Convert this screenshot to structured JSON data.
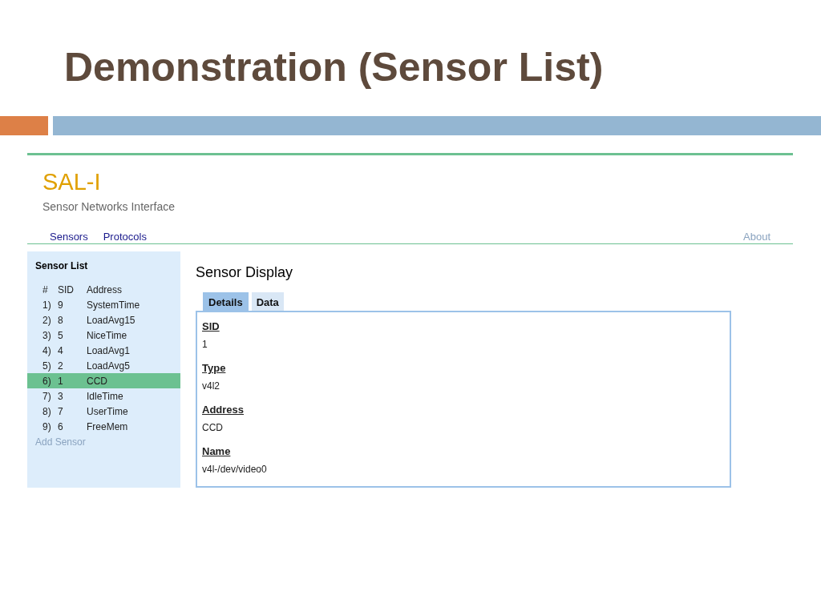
{
  "slide": {
    "title": "Demonstration (Sensor List)"
  },
  "app": {
    "title": "SAL-I",
    "subtitle": "Sensor Networks Interface",
    "nav": [
      {
        "label": "Sensors"
      },
      {
        "label": "Protocols"
      }
    ],
    "nav_right": "About"
  },
  "sidebar": {
    "title": "Sensor List",
    "columns": [
      "#",
      "SID",
      "Address"
    ],
    "rows": [
      {
        "index": "1)",
        "sid": "9",
        "address": "SystemTime",
        "selected": false
      },
      {
        "index": "2)",
        "sid": "8",
        "address": "LoadAvg15",
        "selected": false
      },
      {
        "index": "3)",
        "sid": "5",
        "address": "NiceTime",
        "selected": false
      },
      {
        "index": "4)",
        "sid": "4",
        "address": "LoadAvg1",
        "selected": false
      },
      {
        "index": "5)",
        "sid": "2",
        "address": "LoadAvg5",
        "selected": false
      },
      {
        "index": "6)",
        "sid": "1",
        "address": "CCD",
        "selected": true
      },
      {
        "index": "7)",
        "sid": "3",
        "address": "IdleTime",
        "selected": false
      },
      {
        "index": "8)",
        "sid": "7",
        "address": "UserTime",
        "selected": false
      },
      {
        "index": "9)",
        "sid": "6",
        "address": "FreeMem",
        "selected": false
      }
    ],
    "add_link": "Add Sensor"
  },
  "display": {
    "title": "Sensor Display",
    "tabs": [
      {
        "label": "Details",
        "selected": true
      },
      {
        "label": "Data",
        "selected": false
      }
    ],
    "fields": [
      {
        "label": "SID",
        "value": "1"
      },
      {
        "label": "Type",
        "value": "v4l2"
      },
      {
        "label": "Address",
        "value": "CCD"
      },
      {
        "label": "Name",
        "value": "v4l-/dev/video0"
      }
    ]
  }
}
